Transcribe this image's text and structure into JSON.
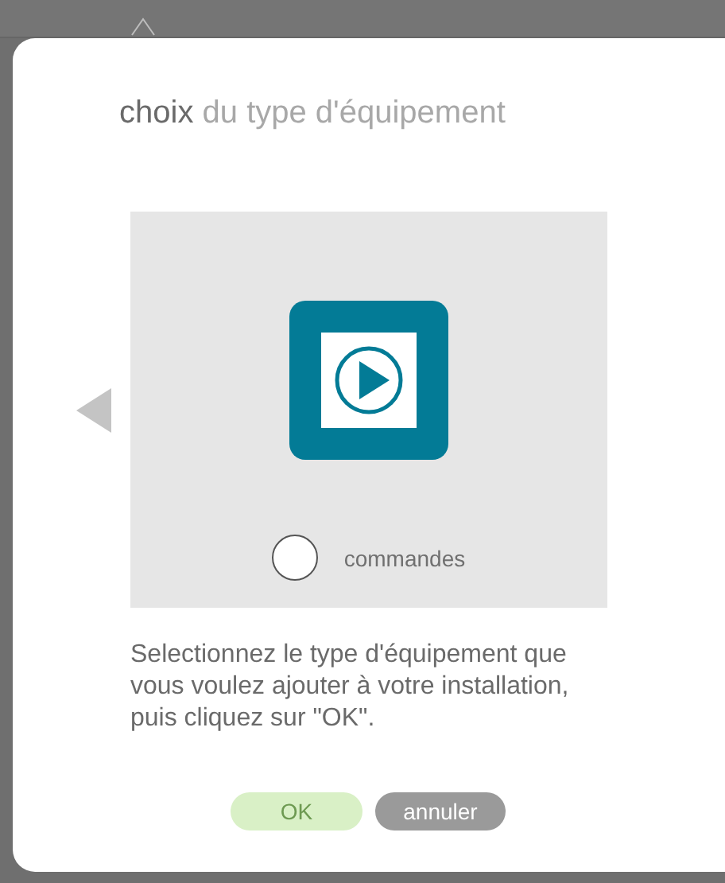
{
  "dialog": {
    "title": "**choix** du type d'équipement",
    "equipment": {
      "label": "commandes",
      "selected": false
    },
    "instructions": "Selectionnez le type d'équipement que vous voulez ajouter à votre installation, puis cliquez sur \"OK\".",
    "buttons": [
      {
        "kind": "ok",
        "label": "OK",
        "disabled": true
      },
      {
        "kind": "cancel",
        "label": "annuler",
        "disabled": false
      }
    ]
  }
}
